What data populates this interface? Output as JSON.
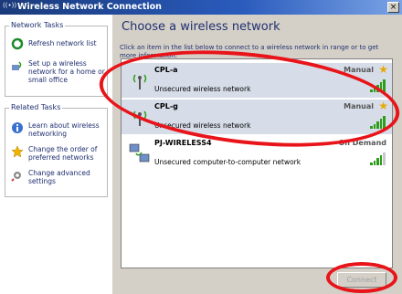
{
  "window": {
    "title": "Wireless Network Connection",
    "close_glyph": "×"
  },
  "left": {
    "network_tasks": {
      "title": "Network Tasks",
      "items": [
        {
          "label": "Refresh network list",
          "icon": "refresh-icon"
        },
        {
          "label": "Set up a wireless network for a home or small office",
          "icon": "setup-network-icon"
        }
      ]
    },
    "related_tasks": {
      "title": "Related Tasks",
      "items": [
        {
          "label": "Learn about wireless networking",
          "icon": "info-icon"
        },
        {
          "label": "Change the order of preferred networks",
          "icon": "star-icon"
        },
        {
          "label": "Change advanced settings",
          "icon": "settings-icon"
        }
      ]
    }
  },
  "main": {
    "heading": "Choose a wireless network",
    "instructions": "Click an item in the list below to connect to a wireless network in range or to get more information.",
    "networks": [
      {
        "name": "CPL-a",
        "description": "Unsecured wireless network",
        "mode": "Manual",
        "preferred": true,
        "signal_bars": 5,
        "icon": "wireless-antenna-icon"
      },
      {
        "name": "CPL-g",
        "description": "Unsecured wireless network",
        "mode": "Manual",
        "preferred": true,
        "signal_bars": 5,
        "icon": "wireless-antenna-icon"
      },
      {
        "name": "PJ-WIRELESS4",
        "description": "Unsecured computer-to-computer network",
        "mode": "On Demand",
        "preferred": false,
        "signal_bars": 4,
        "icon": "computer-to-computer-icon"
      }
    ],
    "connect_label": "Connect"
  },
  "colors": {
    "titlebar": "#2a5bbd",
    "annotation": "#e8141a",
    "signal": "#2c9c1a",
    "task_text": "#1f2f6f"
  }
}
